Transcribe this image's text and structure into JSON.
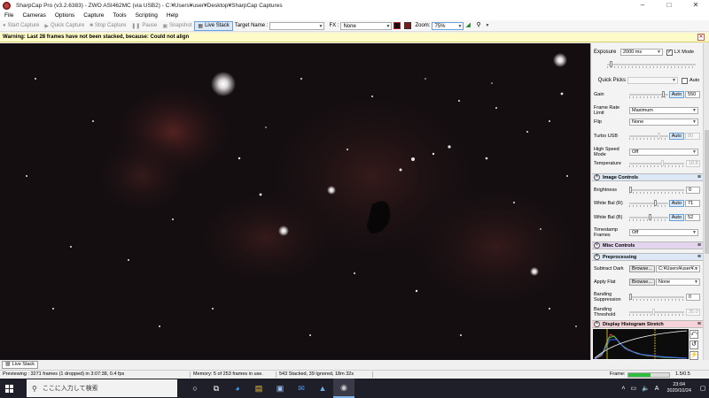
{
  "window": {
    "title": "SharpCap Pro (v3.2.6383) - ZWO ASI462MC (via USB2) - C:¥Users¥user¥Desktop¥SharpCap Captures",
    "minimize": "–",
    "maximize": "□",
    "close": "✕"
  },
  "menu": [
    "File",
    "Cameras",
    "Options",
    "Capture",
    "Tools",
    "Scripting",
    "Help"
  ],
  "toolbar": {
    "start_capture": "Start Capture",
    "quick_capture": "Quick Capture",
    "stop_capture": "Stop Capture",
    "pause": "Pause",
    "snapshot": "Snapshot",
    "live_stack": "Live Stack",
    "target_name_label": "Target Name :",
    "target_name_value": "",
    "fx_label": "FX :",
    "fx_value": "None",
    "zoom_label": "Zoom:",
    "zoom_value": "75%"
  },
  "warning": {
    "message": "Warning: Last 28 frames have not been stacked, because: Could not align",
    "close": "✕"
  },
  "panel": {
    "exposure_label": "Exposure",
    "exposure_value": "2000 ms",
    "lx_mode_label": "LX Mode",
    "lx_mode_checked": true,
    "quick_picks_label": "Quick Picks",
    "quick_picks_value": "",
    "auto_label": "Auto",
    "gain_label": "Gain",
    "gain_auto": "Auto",
    "gain_value": "550",
    "gain_level": 0.92,
    "frame_rate_label": "Frame Rate Limit",
    "frame_rate_value": "Maximum",
    "flip_label": "Flip",
    "flip_value": "None",
    "turbo_usb_label": "Turbo USB",
    "turbo_usb_auto": "Auto",
    "turbo_usb_value": "80",
    "high_speed_label": "High Speed Mode",
    "high_speed_value": "Off",
    "temperature_label": "Temperature",
    "temperature_value": "18.8",
    "image_controls": "Image Controls",
    "brightness_label": "Brightness",
    "brightness_value": "0",
    "wb_r_label": "White Bal (R)",
    "wb_r_auto": "Auto",
    "wb_r_value": "71",
    "wb_b_label": "White Bal (B)",
    "wb_b_auto": "Auto",
    "wb_b_value": "52",
    "timestamp_label": "Timestamp Frames",
    "timestamp_value": "Off",
    "misc_controls": "Misc Controls",
    "preprocessing": "Preprocessing",
    "subtract_dark_label": "Subtract Dark",
    "browse": "Browse...",
    "subtract_dark_value": "C:¥Users¥user¥...",
    "apply_flat_label": "Apply Flat",
    "apply_flat_value": "None",
    "banding_supp_label": "Banding Suppression",
    "banding_supp_value": "0",
    "banding_thresh_label": "Banding Threshold",
    "banding_thresh_value": "35.0",
    "display_histogram": "Display Histogram Stretch"
  },
  "bottom_tab": "Live Stack",
  "status": {
    "previewing": "Previewing : 3271 frames (1 dropped) in 3:07:38, 0.4 fps",
    "memory": "Memory: 5 of 253 frames in use.",
    "stacked": "543 Stacked, 39 Ignored, 18m 32s",
    "frame_label": "Frame:",
    "frame_progress": 0.55,
    "frame_time": "1.5/0.5"
  },
  "taskbar": {
    "search_placeholder": "ここに入力して検索",
    "time": "23:04",
    "date": "2020/10/24"
  },
  "colors": {
    "accent_blue": "#6aa0d8",
    "warning_bg": "#fffbc8",
    "section_blue": "#dce8f5",
    "section_purple": "#e3d5ee",
    "section_pink": "#f6d3d8",
    "frame_green": "#2fbf3c"
  }
}
